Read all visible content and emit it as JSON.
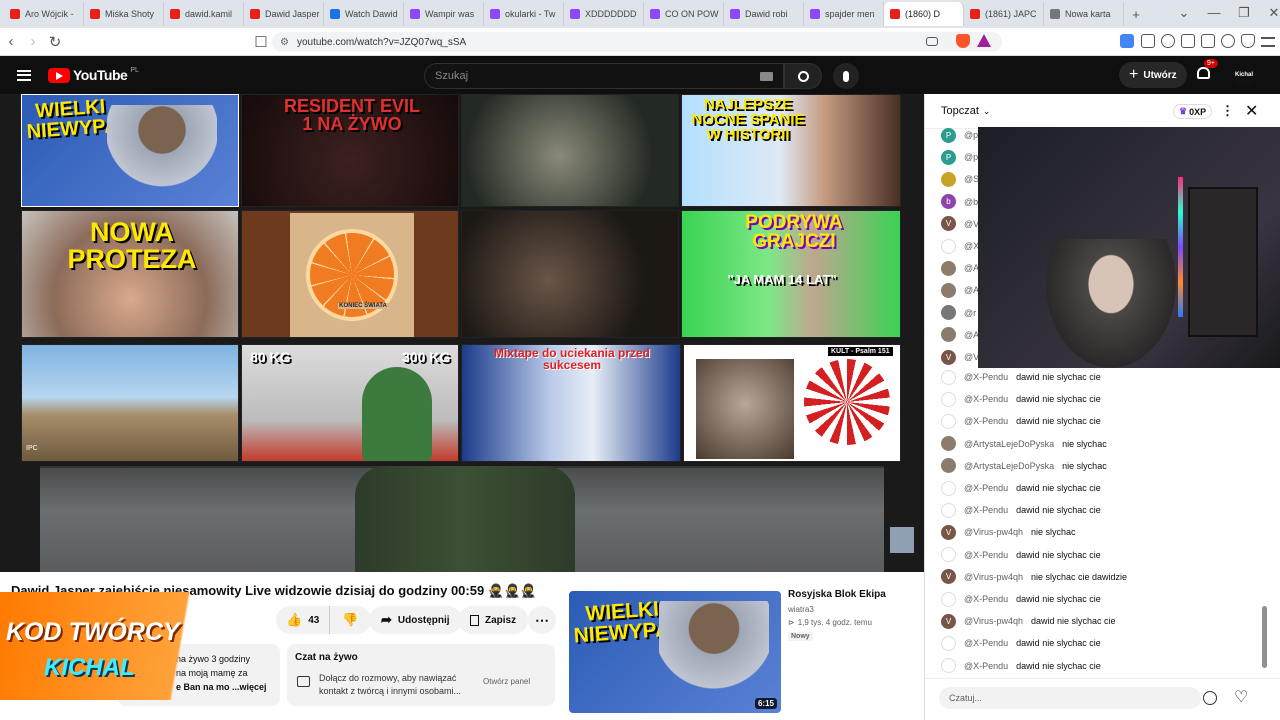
{
  "browser": {
    "tabs": [
      {
        "label": "Aro Wójcik -",
        "color": "#e62117"
      },
      {
        "label": "Miśka Shoty",
        "color": "#e62117"
      },
      {
        "label": "dawid.kamil",
        "color": "#e62117"
      },
      {
        "label": "Dawid Jasper",
        "color": "#e62117"
      },
      {
        "label": "Watch Dawid",
        "color": "#1a73e8"
      },
      {
        "label": "Wampir was",
        "color": "#9146ff"
      },
      {
        "label": "okularki - Tw",
        "color": "#9146ff"
      },
      {
        "label": "XDDDDDDD",
        "color": "#9146ff"
      },
      {
        "label": "CO ON POW",
        "color": "#9146ff"
      },
      {
        "label": "Dawid robi",
        "color": "#9146ff"
      },
      {
        "label": "spajder men",
        "color": "#9146ff"
      },
      {
        "label": "(1860) D",
        "color": "#e62117"
      },
      {
        "label": "(1861) JAPC",
        "color": "#e62117"
      },
      {
        "label": "Nowa karta",
        "color": "#777777"
      }
    ],
    "url": "youtube.com/watch?v=JZQ07wq_sSA"
  },
  "youtube": {
    "logo": "YouTube",
    "region": "PL",
    "search_placeholder": "Szukaj",
    "create_label": "Utwórz",
    "notif_count": "9+",
    "avatar_text": "Kichal"
  },
  "video": {
    "thumb_texts": {
      "t1": "WIELKI NIEWYPAŁ",
      "t2": "RESIDENT EVIL 1 NA ŻYWO",
      "t4": "NAJLEPSZE NOCNE SPANIE W HISTORII",
      "t5": "NOWA PROTEZA",
      "t6": "KONIEC ŚWIATA",
      "t8": "PODRYWA GRAJCZI",
      "t8b": "\"JA MAM 14 LAT\"",
      "t9": "IPC",
      "t10a": "80 KG",
      "t10b": "300 KG",
      "t11": "Mixtape do uciekania przed sukcesem",
      "t12": "KULT - Psalm 151"
    }
  },
  "below": {
    "title": "Dawid Jasper zajebiście niesamowity Live widzowie dzisiaj do godziny 00:59 🥷🥷🥷",
    "likes": "43",
    "share_label": "Udostępnij",
    "save_label": "Zapisz",
    "badge_line1": "KOD TWÓRCY",
    "badge_line2": "KICHAL",
    "desc_line1": "na żywo 3 godziny",
    "desc_line2": "na moją mamę za",
    "desc_line3": "e Ban  na mo  ...więcej",
    "chat_title": "Czat na żywo",
    "chat_desc": "Dołącz do rozmowy, aby nawiązać kontakt z twórcą i innymi osobami...",
    "chat_open": "Otwórz panel",
    "rec_title": "Rosyjska Blok Ekipa",
    "rec_channel": "wiatra3",
    "rec_meta": "1,9 tys.  4 godz. temu",
    "rec_new": "Nowy",
    "rec_duration": "6:15",
    "rec_thumb_text": "WIELKI NIEWYPAŁ"
  },
  "chat": {
    "header": "Topczat",
    "points": "0XP",
    "input_placeholder": "Czatuj...",
    "hidden_rows": [
      {
        "initial": "P",
        "color": "#2a9d8f",
        "name": "@p"
      },
      {
        "initial": "P",
        "color": "#2a9d8f",
        "name": "@p"
      },
      {
        "initial": "",
        "color": "#c9a227",
        "name": "@S"
      },
      {
        "initial": "b",
        "color": "#8e44ad",
        "name": "@b"
      },
      {
        "initial": "V",
        "color": "#795548",
        "name": "@V"
      },
      {
        "initial": "",
        "color": "#ffffff",
        "name": "@X"
      },
      {
        "initial": "",
        "color": "#8d7b6b",
        "name": "@A"
      },
      {
        "initial": "",
        "color": "#8d7b6b",
        "name": "@A"
      },
      {
        "initial": "",
        "color": "#777777",
        "name": "@r"
      },
      {
        "initial": "",
        "color": "#8d7b6b",
        "name": "@A"
      },
      {
        "initial": "V",
        "color": "#795548",
        "name": "@V"
      }
    ],
    "messages": [
      {
        "initial": "",
        "color": "#ffffff",
        "name": "@X-Pendu",
        "text": "dawid nie slychac cie"
      },
      {
        "initial": "",
        "color": "#ffffff",
        "name": "@X-Pendu",
        "text": "dawid nie slychac cie"
      },
      {
        "initial": "",
        "color": "#ffffff",
        "name": "@X-Pendu",
        "text": "dawid nie slychac cie"
      },
      {
        "initial": "",
        "color": "#8d7b6b",
        "name": "@ArtystaLejeDoPyska",
        "text": "nie slychac"
      },
      {
        "initial": "",
        "color": "#8d7b6b",
        "name": "@ArtystaLejeDoPyska",
        "text": "nie slychac"
      },
      {
        "initial": "",
        "color": "#ffffff",
        "name": "@X-Pendu",
        "text": "dawid nie slychac cie"
      },
      {
        "initial": "",
        "color": "#ffffff",
        "name": "@X-Pendu",
        "text": "dawid nie slychac cie"
      },
      {
        "initial": "V",
        "color": "#795548",
        "name": "@Virus-pw4qh",
        "text": "nie slychac"
      },
      {
        "initial": "",
        "color": "#ffffff",
        "name": "@X-Pendu",
        "text": "dawid nie slychac cie"
      },
      {
        "initial": "V",
        "color": "#795548",
        "name": "@Virus-pw4qh",
        "text": "nie slychac cie dawidzie"
      },
      {
        "initial": "",
        "color": "#ffffff",
        "name": "@X-Pendu",
        "text": "dawid nie slychac cie"
      },
      {
        "initial": "V",
        "color": "#795548",
        "name": "@Virus-pw4qh",
        "text": "dawid nie slychac cie"
      },
      {
        "initial": "",
        "color": "#ffffff",
        "name": "@X-Pendu",
        "text": "dawid nie slychac cie"
      },
      {
        "initial": "",
        "color": "#ffffff",
        "name": "@X-Pendu",
        "text": "dawid nie slychac cie"
      }
    ]
  }
}
